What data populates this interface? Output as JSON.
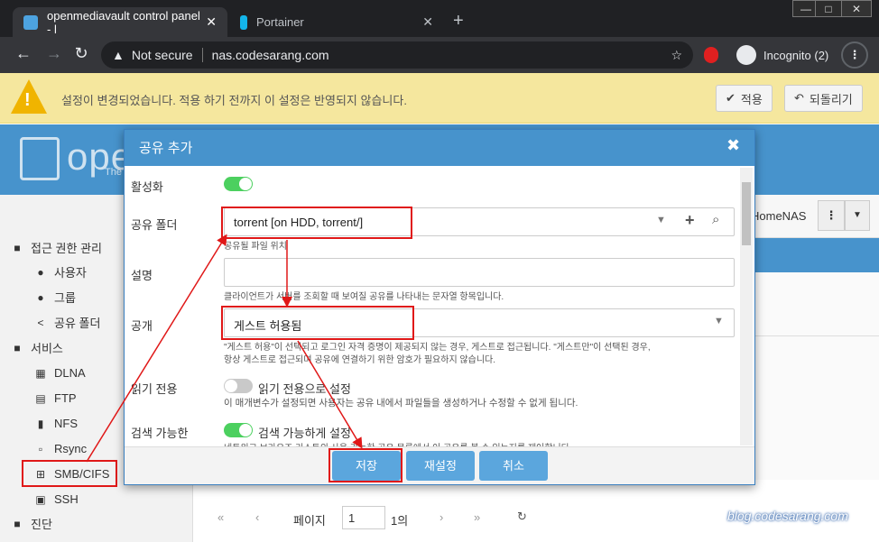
{
  "browser": {
    "tabs": [
      {
        "title": "openmediavault control panel - l"
      },
      {
        "title": "Portainer"
      }
    ],
    "new_tab": "+",
    "url_prefix": "Not secure",
    "url": "nas.codesarang.com",
    "incognito": "Incognito (2)",
    "window_controls": [
      "—",
      "□",
      "✕"
    ]
  },
  "warning": {
    "text": "설정이 변경되었습니다. 적용 하기 전까지 이 설정은 반영되지 않습니다.",
    "apply_label": "적용",
    "revert_label": "되돌리기"
  },
  "header": {
    "logo_text": "ope",
    "logo_sub": "The",
    "host": "HomeNAS"
  },
  "sidebar": {
    "items": [
      {
        "label": "접근 권한 관리",
        "type": "category",
        "icon": "minus-square-icon"
      },
      {
        "label": "사용자",
        "type": "sub",
        "icon": "user-icon"
      },
      {
        "label": "그룹",
        "type": "sub",
        "icon": "users-icon"
      },
      {
        "label": "공유 폴더",
        "type": "sub",
        "icon": "share-icon"
      },
      {
        "label": "서비스",
        "type": "category",
        "icon": "minus-square-icon"
      },
      {
        "label": "DLNA",
        "type": "sub",
        "icon": "film-icon"
      },
      {
        "label": "FTP",
        "type": "sub",
        "icon": "network-icon"
      },
      {
        "label": "NFS",
        "type": "sub",
        "icon": "server-icon"
      },
      {
        "label": "Rsync",
        "type": "sub",
        "icon": "sitemap-icon"
      },
      {
        "label": "SMB/CIFS",
        "type": "sub",
        "icon": "windows-icon"
      },
      {
        "label": "SSH",
        "type": "sub",
        "icon": "terminal-icon"
      },
      {
        "label": "진단",
        "type": "category",
        "icon": "minus-square-icon"
      }
    ]
  },
  "modal": {
    "title": "공유 추가",
    "enable_label": "활성화",
    "shared_folder_label": "공유 폴더",
    "shared_folder_value": "torrent [on HDD, torrent/]",
    "shared_folder_help": "공유될 파일 위치",
    "comment_label": "설명",
    "comment_help": "클라이언트가 서버를 조회할 때 보여질 공유를 나타내는 문자열 항목입니다.",
    "public_label": "공개",
    "public_value": "게스트 허용됨",
    "public_help_1": "\"게스트 허용\"이 선택되고 로그인 자격 증명이 제공되지 않는 경우, 게스트로 접근됩니다. \"게스트만\"이 선택된 경우,",
    "public_help_2": "항상 게스트로 접근되며 공유에 연결하기 위한 암호가 필요하지 않습니다.",
    "readonly_label": "읽기 전용",
    "readonly_toggle_label": "읽기 전용으로 설정",
    "readonly_help": "이 매개변수가 설정되면 사용자는 공유 내에서 파일들을 생성하거나 수정할 수 없게 됩니다.",
    "browsable_label": "검색 가능한",
    "browsable_toggle_label": "검색 가능하게 설정",
    "browsable_help": "네트워크 브라우즈 리스트의 사용 가능한 공유 목록에서 이 공유를 볼 수 있는지를 제어합니다.",
    "save_label": "저장",
    "reset_label": "재설정",
    "cancel_label": "취소",
    "enabled": true,
    "readonly": false,
    "browsable": true
  },
  "pager": {
    "page_label": "페이지",
    "page_value": "1",
    "of_label": "1의"
  },
  "watermark": "blog.codesarang.com",
  "colors": {
    "accent": "#4793cc",
    "toggle_on": "#4cd05f",
    "annotation": "#e01818",
    "warning_bg": "#f5e79e"
  }
}
